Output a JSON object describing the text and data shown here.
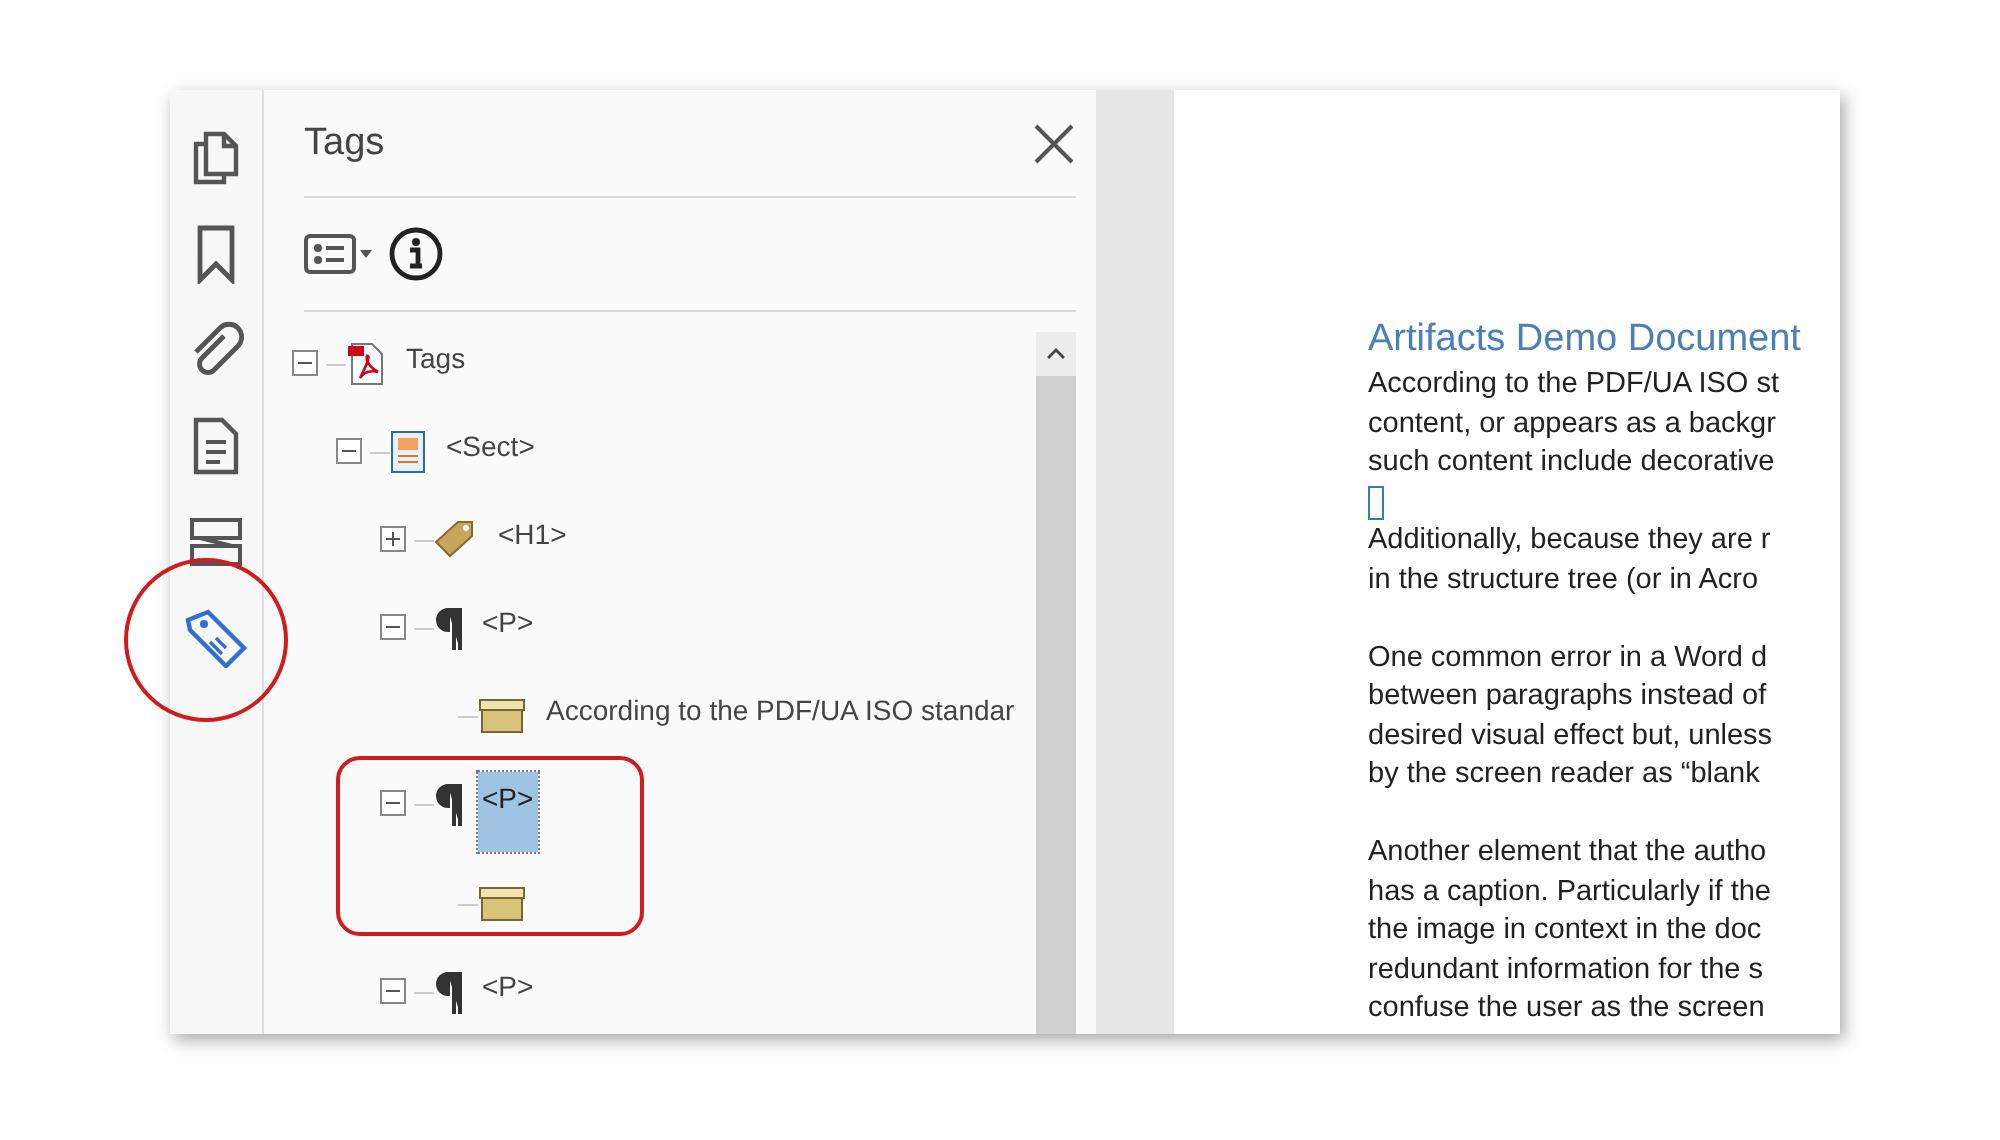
{
  "rail": [
    {
      "kind": "pages",
      "selected": false
    },
    {
      "kind": "bookmark",
      "selected": false
    },
    {
      "kind": "attachment",
      "selected": false
    },
    {
      "kind": "document",
      "selected": false
    },
    {
      "kind": "compare",
      "selected": false
    },
    {
      "kind": "tag",
      "selected": true
    }
  ],
  "tags_panel": {
    "title": "Tags",
    "tree": [
      {
        "kind": "root",
        "label": "Tags",
        "expanded": true,
        "selected": false,
        "children": [
          {
            "kind": "section",
            "label": "<Sect>",
            "expanded": true,
            "selected": false,
            "children": [
              {
                "kind": "heading",
                "label": "<H1>",
                "expanded": false,
                "selected": false
              },
              {
                "kind": "paragraph",
                "label": "<P>",
                "expanded": true,
                "selected": false,
                "children": [
                  {
                    "kind": "content",
                    "label": "According to the PDF/UA ISO standar",
                    "selected": false
                  }
                ]
              },
              {
                "kind": "paragraph",
                "label": "<P>",
                "expanded": true,
                "selected": true,
                "children": [
                  {
                    "kind": "content",
                    "selected": false
                  }
                ]
              },
              {
                "kind": "paragraph",
                "label": "<P>",
                "expanded": true,
                "selected": false
              }
            ]
          }
        ]
      }
    ]
  },
  "document": {
    "title": "Artifacts Demo Document",
    "paragraphs": [
      [
        "According to the PDF/UA ISO st",
        "content, or appears as a backgr",
        "such content include decorative"
      ],
      [
        "Additionally, because they are r",
        "in the structure tree (or in Acro"
      ],
      [
        "One common error in a Word d",
        "between paragraphs instead of",
        "desired visual effect but, unless",
        "by the screen reader as “blank"
      ],
      [
        "Another element that the autho",
        "has a caption. Particularly if the",
        "the image in context in the doc",
        "redundant information for the s",
        "confuse the user as the screen"
      ]
    ]
  }
}
